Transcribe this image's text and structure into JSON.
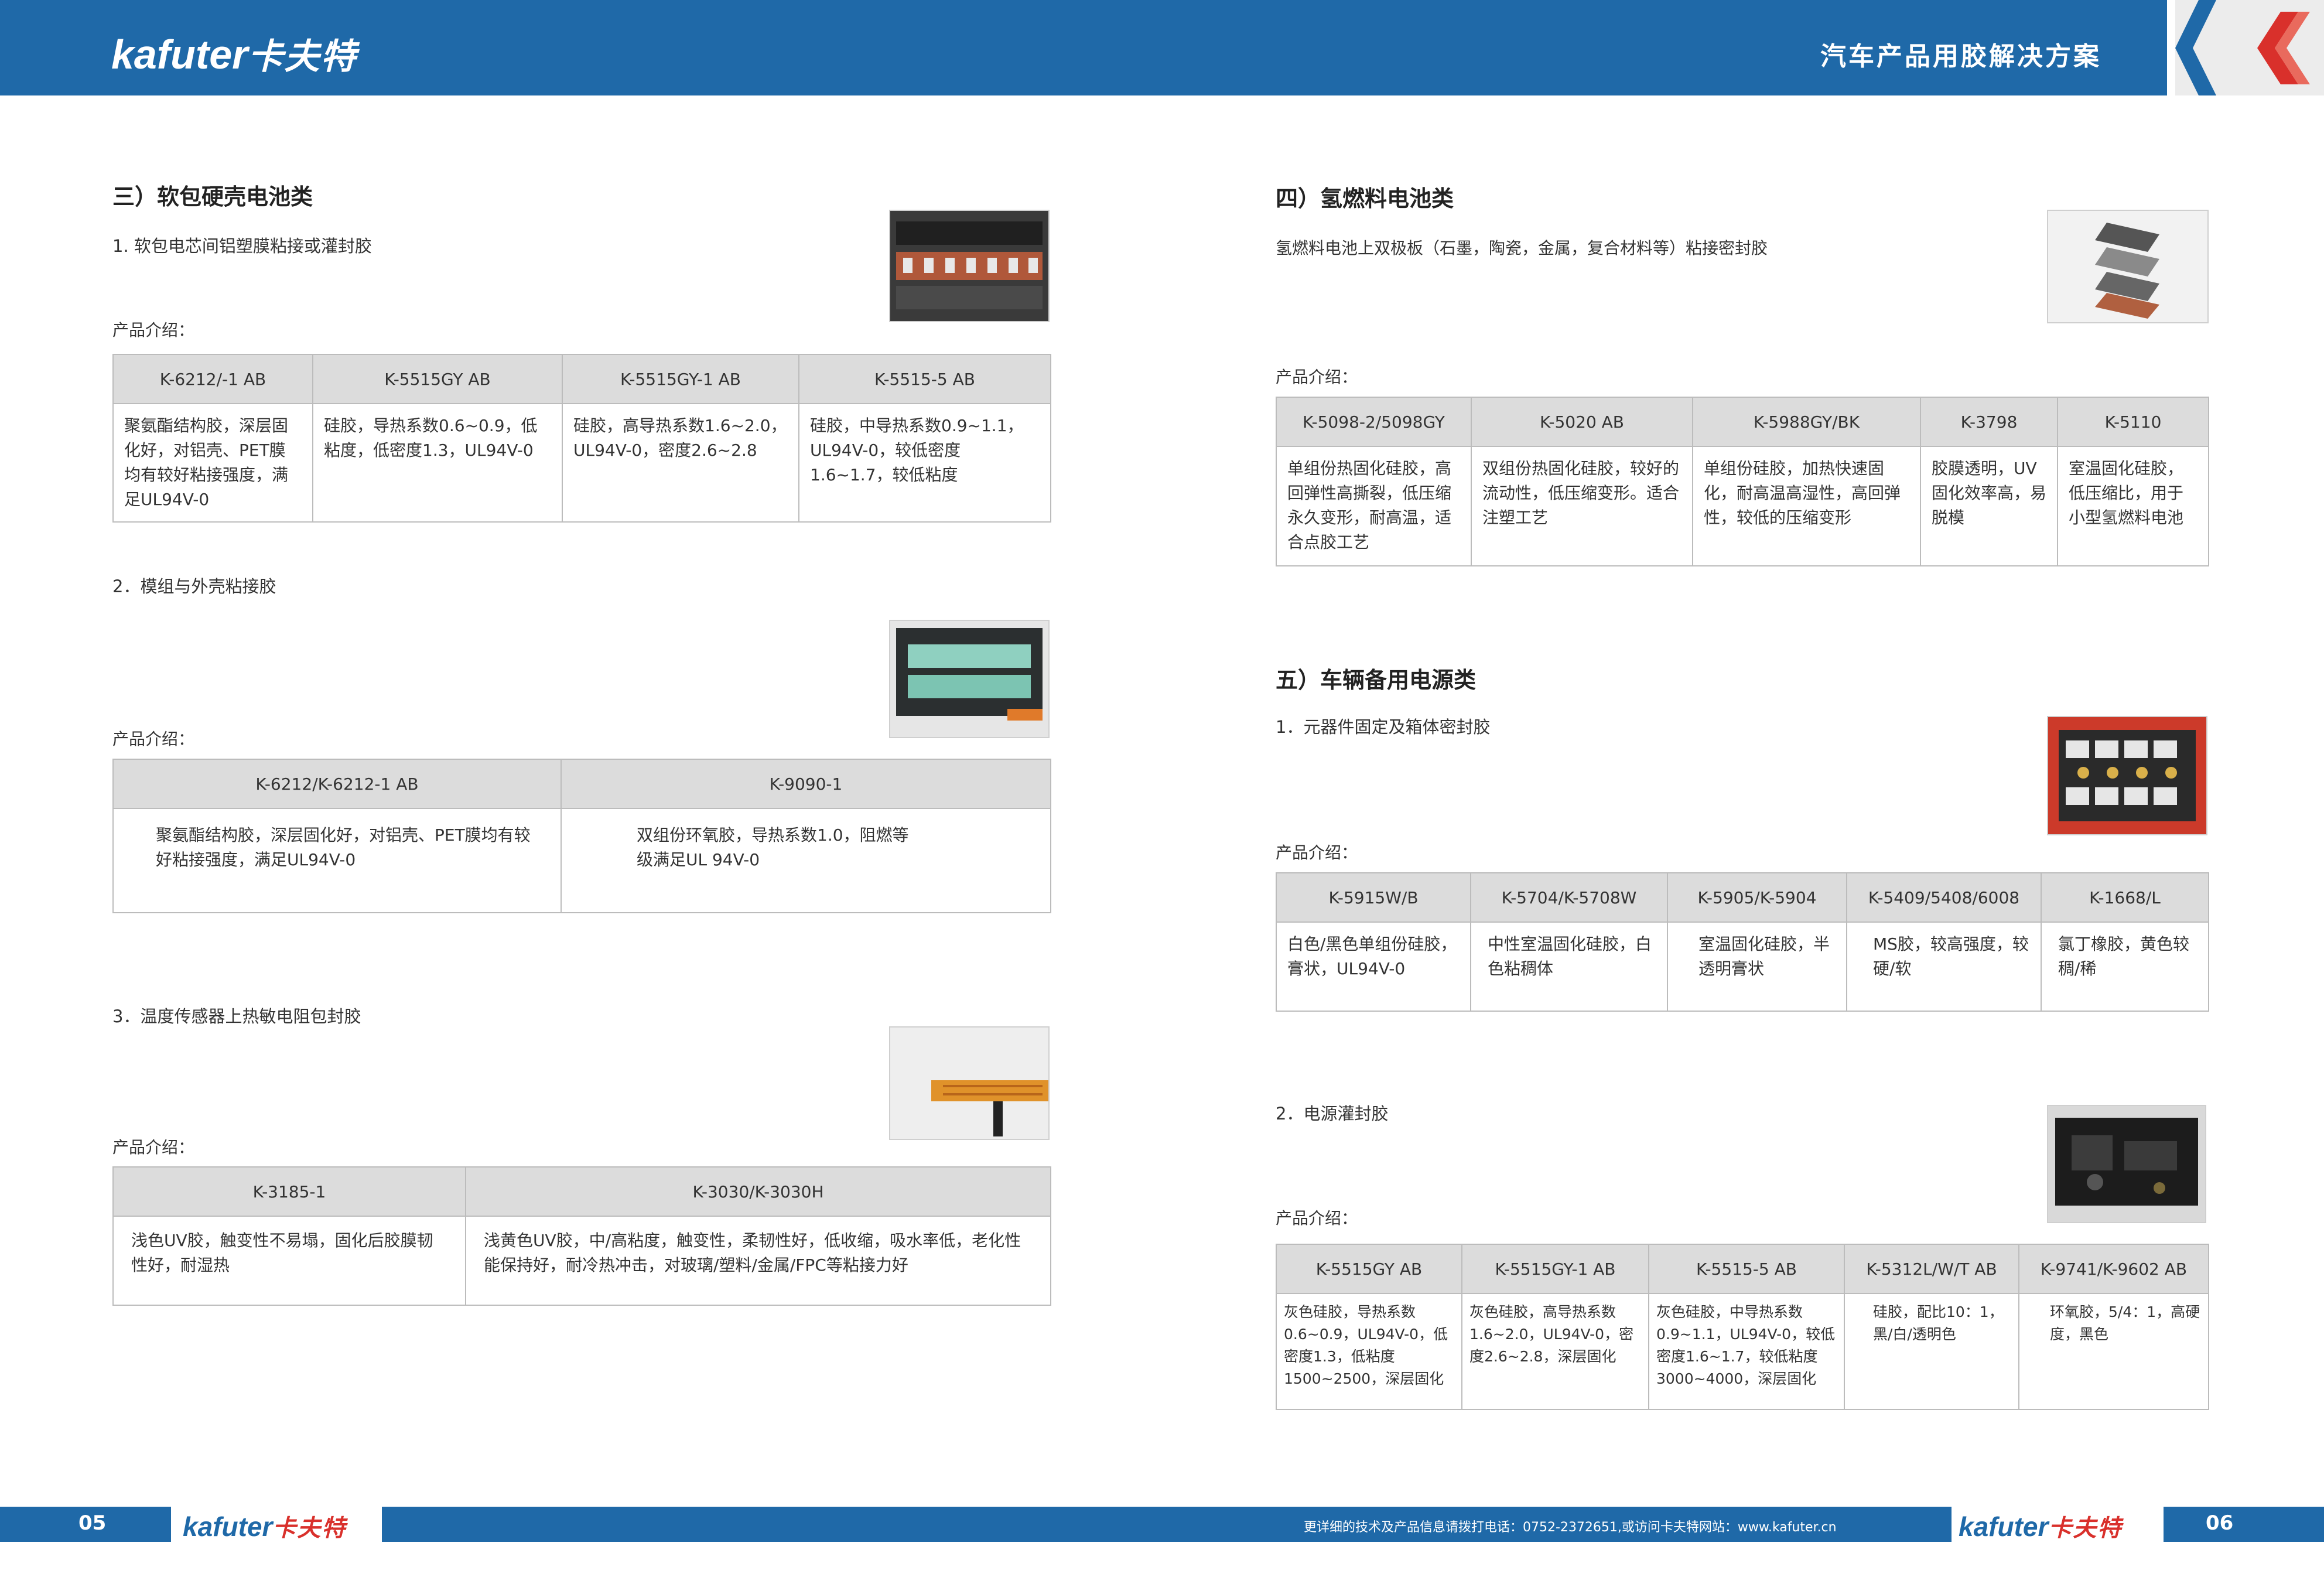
{
  "header": {
    "brand_en": "kafuter",
    "brand_cn": "卡夫特",
    "title": "汽车产品用胶解决方案"
  },
  "left": {
    "section_title": "三）软包硬壳电池类",
    "item1": {
      "title": "1. 软包电芯间铝塑膜粘接或灌封胶",
      "intro": "产品介绍：",
      "headers": [
        "K-6212/-1 AB",
        "K-5515GY AB",
        "K-5515GY-1 AB",
        "K-5515-5 AB"
      ],
      "cells": [
        "聚氨酯结构胶，深层固化好，对铝壳、PET膜均有较好粘接强度，满足UL94V-0",
        "硅胶，导热系数0.6~0.9，低粘度，低密度1.3，UL94V-0",
        "硅胶，高导热系数1.6~2.0，UL94V-0，密度2.6~2.8",
        "硅胶，中导热系数0.9~1.1，UL94V-0，较低密度1.6~1.7，较低粘度"
      ]
    },
    "item2": {
      "title": "2．模组与外壳粘接胶",
      "intro": "产品介绍：",
      "headers": [
        "K-6212/K-6212-1 AB",
        "K-9090-1"
      ],
      "cells": [
        "聚氨酯结构胶，深层固化好，对铝壳、PET膜均有较好粘接强度，满足UL94V-0",
        "双组份环氧胶，导热系数1.0，阻燃等级满足UL 94V-0"
      ]
    },
    "item3": {
      "title": "3．温度传感器上热敏电阻包封胶",
      "intro": "产品介绍：",
      "headers": [
        "K-3185-1",
        "K-3030/K-3030H"
      ],
      "cells": [
        "浅色UV胶，触变性不易塌，固化后胶膜韧性好，耐湿热",
        "浅黄色UV胶，中/高粘度，触变性，柔韧性好，低收缩，吸水率低，老化性能保持好，耐冷热冲击，对玻璃/塑料/金属/FPC等粘接力好"
      ]
    }
  },
  "right": {
    "section4": {
      "title": "四）氢燃料电池类",
      "desc": "氢燃料电池上双极板（石墨，陶瓷，金属，复合材料等）粘接密封胶",
      "intro": "产品介绍：",
      "headers": [
        "K-5098-2/5098GY",
        "K-5020 AB",
        "K-5988GY/BK",
        "K-3798",
        "K-5110"
      ],
      "cells": [
        "单组份热固化硅胶，高回弹性高撕裂，低压缩永久变形，耐高温，适合点胶工艺",
        "双组份热固化硅胶，较好的流动性，低压缩变形。适合注塑工艺",
        "单组份硅胶，加热快速固化，耐高温高湿性，高回弹性，较低的压缩变形",
        "胶膜透明，UV固化效率高，易脱模",
        "室温固化硅胶，低压缩比，用于小型氢燃料电池"
      ]
    },
    "section5": {
      "title": "五）车辆备用电源类",
      "item1": {
        "title": "1．元器件固定及箱体密封胶",
        "intro": "产品介绍：",
        "headers": [
          "K-5915W/B",
          "K-5704/K-5708W",
          "K-5905/K-5904",
          "K-5409/5408/6008",
          "K-1668/L"
        ],
        "cells": [
          "白色/黑色单组份硅胶，膏状，UL94V-0",
          "中性室温固化硅胶，白色粘稠体",
          "室温固化硅胶，半透明膏状",
          "MS胶，较高强度，较硬/软",
          "氯丁橡胶，黄色较稠/稀"
        ]
      },
      "item2": {
        "title": "2．电源灌封胶",
        "intro": "产品介绍：",
        "headers": [
          "K-5515GY AB",
          "K-5515GY-1 AB",
          "K-5515-5 AB",
          "K-5312L/W/T AB",
          "K-9741/K-9602 AB"
        ],
        "cells": [
          "灰色硅胶，导热系数0.6~0.9，UL94V-0，低密度1.3，低粘度1500~2500，深层固化",
          "灰色硅胶，高导热系数1.6~2.0，UL94V-0，密度2.6~2.8，深层固化",
          "灰色硅胶，中导热系数0.9~1.1，UL94V-0，较低密度1.6~1.7，较低粘度3000~4000，深层固化",
          "硅胶，配比10：1，黑/白/透明色",
          "环氧胶，5/4：1，高硬度，黑色"
        ]
      }
    }
  },
  "footer": {
    "page_left": "05",
    "page_right": "06",
    "brand_en": "kafuter",
    "brand_cn": "卡夫特",
    "note": "更详细的技术及产品信息请拨打电话：0752-2372651,或访问卡夫特网站：www.kafuter.cn"
  },
  "colors": {
    "brand_blue": "#1f69a8",
    "header_gray": "#dcdcdc",
    "chevron_red": "#d9302b"
  }
}
